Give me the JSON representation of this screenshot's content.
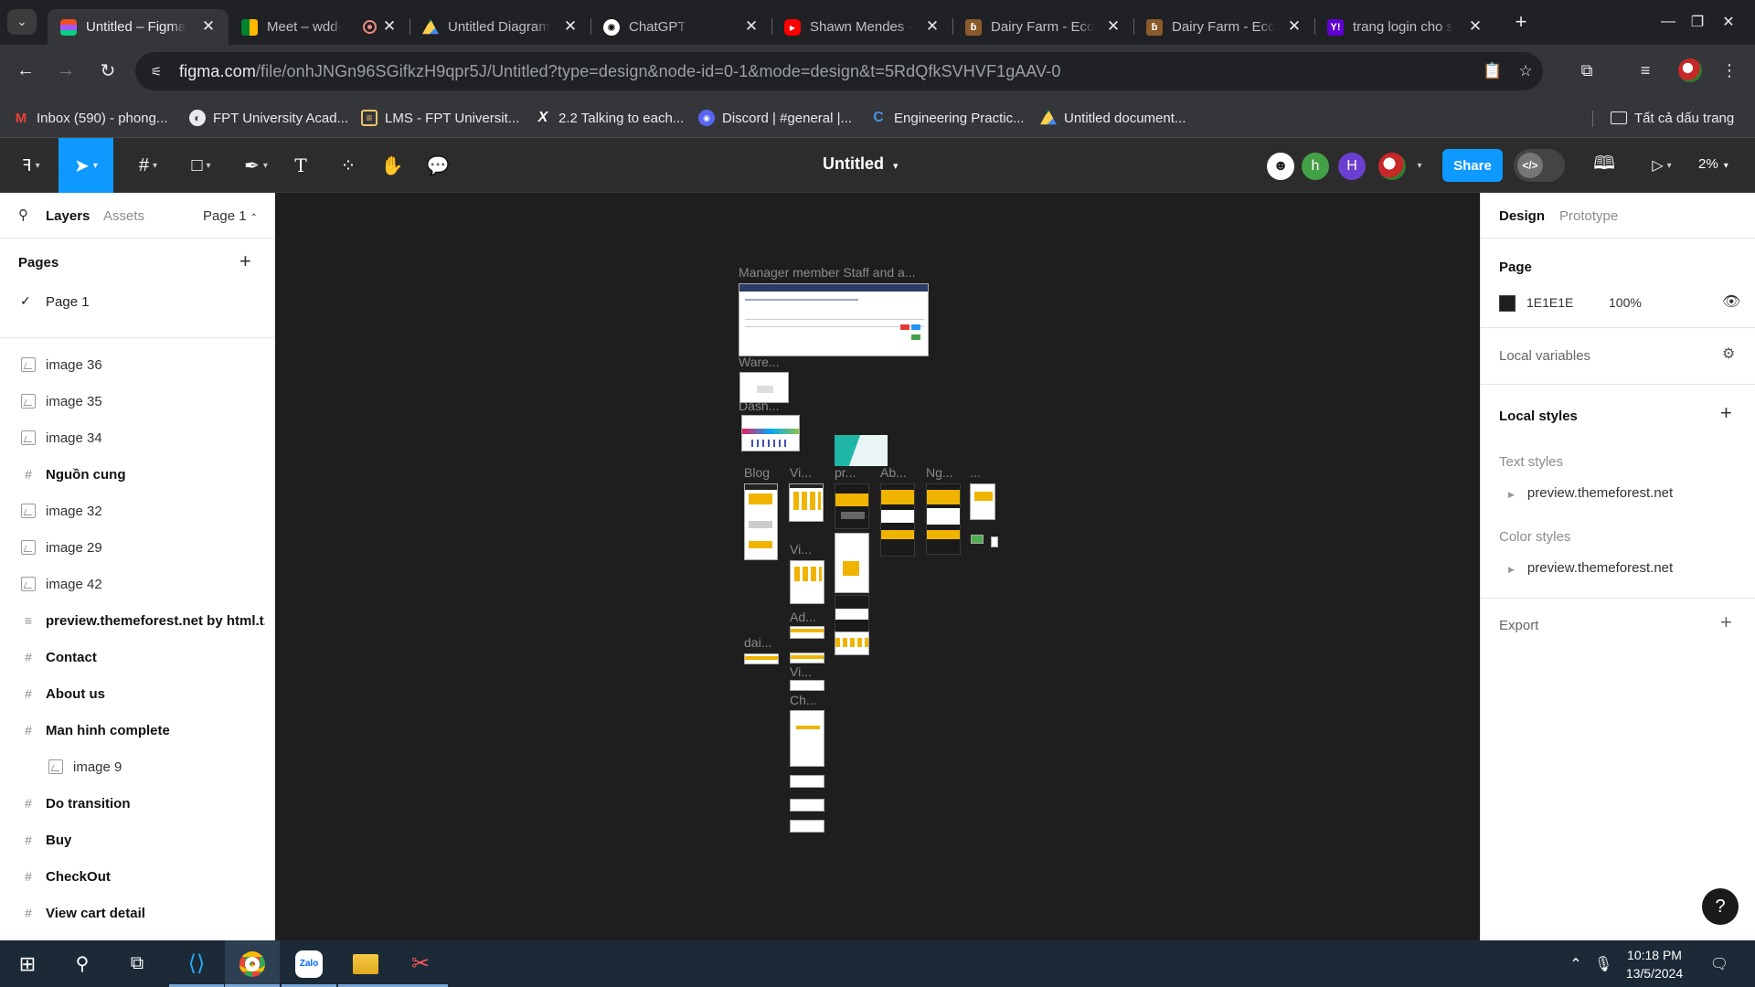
{
  "browser": {
    "tabs": [
      {
        "label": "Untitled – Figma",
        "favicon": "figma-icon",
        "active": true
      },
      {
        "label": "Meet – wdd-",
        "favicon": "meet-icon",
        "recording": true
      },
      {
        "label": "Untitled Diagram",
        "favicon": "drive-icon"
      },
      {
        "label": "ChatGPT",
        "favicon": "chatgpt-icon"
      },
      {
        "label": "Shawn Mendes -",
        "favicon": "youtube-icon"
      },
      {
        "label": "Dairy Farm - Eco",
        "favicon": "dairy-icon"
      },
      {
        "label": "Dairy Farm - Eco",
        "favicon": "dairy-icon"
      },
      {
        "label": "trang login cho s",
        "favicon": "yahoo-icon"
      }
    ],
    "url_host": "figma.com",
    "url_path": "/file/onhJNGn96SGifkzH9qpr5J/Untitled?type=design&node-id=0-1&mode=design&t=5RdQfkSVHVF1gAAV-0",
    "bookmarks": [
      {
        "label": "Inbox (590) - phong...",
        "icon": "gmail-icon"
      },
      {
        "label": "FPT University Acad...",
        "icon": "globe-icon"
      },
      {
        "label": "LMS - FPT Universit...",
        "icon": "lms-icon"
      },
      {
        "label": "2.2 Talking to each...",
        "icon": "x-icon"
      },
      {
        "label": "Discord | #general |...",
        "icon": "discord-icon"
      },
      {
        "label": "Engineering Practic...",
        "icon": "coursera-icon"
      },
      {
        "label": "Untitled document...",
        "icon": "drive-icon"
      }
    ],
    "all_bookmarks_label": "Tất cả dấu trang"
  },
  "figma": {
    "file_title": "Untitled",
    "share_label": "Share",
    "zoom": "2%",
    "collaborators": [
      {
        "initial": "",
        "color": "#ffffff"
      },
      {
        "initial": "h",
        "color": "#43a047"
      },
      {
        "initial": "H",
        "color": "#6a3fd0"
      }
    ],
    "left_panel": {
      "tab_layers": "Layers",
      "tab_assets": "Assets",
      "page_selector": "Page 1",
      "pages_heading": "Pages",
      "pages": [
        "Page 1"
      ],
      "layers": [
        {
          "name": "image 36",
          "type": "image",
          "indent": 0
        },
        {
          "name": "image 35",
          "type": "image",
          "indent": 0
        },
        {
          "name": "image 34",
          "type": "image",
          "indent": 0
        },
        {
          "name": "Nguồn cung",
          "type": "frame",
          "indent": 0
        },
        {
          "name": "image 32",
          "type": "image",
          "indent": 0
        },
        {
          "name": "image 29",
          "type": "image",
          "indent": 0
        },
        {
          "name": "image 42",
          "type": "image",
          "indent": 0
        },
        {
          "name": "preview.themeforest.net by html.t...",
          "type": "text",
          "indent": 0
        },
        {
          "name": "Contact",
          "type": "frame",
          "indent": 0
        },
        {
          "name": "About us",
          "type": "frame",
          "indent": 0
        },
        {
          "name": "Man hinh complete",
          "type": "frame",
          "indent": 0
        },
        {
          "name": "image 9",
          "type": "image",
          "indent": 1
        },
        {
          "name": "Do transition",
          "type": "frame",
          "indent": 0
        },
        {
          "name": "Buy",
          "type": "frame",
          "indent": 0
        },
        {
          "name": "CheckOut",
          "type": "frame",
          "indent": 0
        },
        {
          "name": "View cart detail",
          "type": "frame",
          "indent": 0
        }
      ]
    },
    "canvas": {
      "frame_labels": [
        "Manager member Staff and a...",
        "Ware...",
        "Dash...",
        "Blog",
        "Vi...",
        "pr...",
        "Ab...",
        "Ng...",
        "...",
        "Vi...",
        "Ad...",
        "dai...",
        "Vi...",
        "Ch..."
      ]
    },
    "right_panel": {
      "tab_design": "Design",
      "tab_prototype": "Prototype",
      "page_heading": "Page",
      "page_color_hex": "1E1E1E",
      "page_color": "#1e1e1e",
      "page_opacity": "100%",
      "local_variables": "Local variables",
      "local_styles": "Local styles",
      "text_styles_heading": "Text styles",
      "text_style_item": "preview.themeforest.net",
      "color_styles_heading": "Color styles",
      "color_style_item": "preview.themeforest.net",
      "export_label": "Export"
    }
  },
  "taskbar": {
    "time": "10:18 PM",
    "date": "13/5/2024"
  },
  "colors": {
    "figma_accent": "#0d99ff",
    "canvas_bg": "#1e1e1e",
    "chrome_dark": "#202124"
  }
}
